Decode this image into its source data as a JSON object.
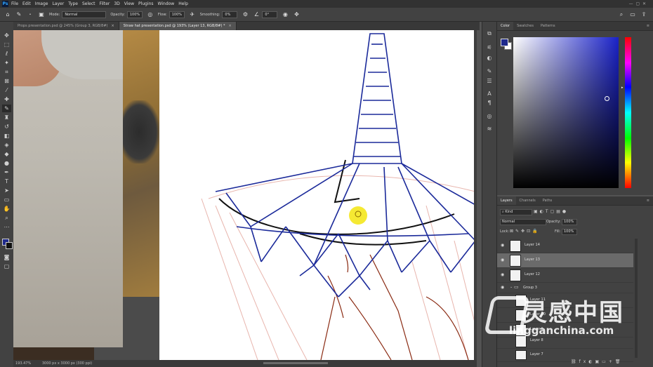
{
  "app": {
    "menu": [
      "File",
      "Edit",
      "Image",
      "Layer",
      "Type",
      "Select",
      "Filter",
      "3D",
      "View",
      "Plugins",
      "Window",
      "Help"
    ]
  },
  "options": {
    "mode_label": "Mode:",
    "mode_value": "Normal",
    "opacity_label": "Opacity:",
    "opacity_value": "100%",
    "flow_label": "Flow:",
    "flow_value": "100%",
    "smoothing_label": "Smoothing:",
    "smoothing_value": "0%",
    "angle_value": "0°"
  },
  "tabs": [
    {
      "label": "Props presentation.psd @ 245% (Group 3, RGB/8#)"
    },
    {
      "label": "Straw hat presentation.psd @ 193% (Layer 13, RGB/8#) *"
    }
  ],
  "status": {
    "zoom": "193.47%",
    "doc": "3000 px x 3000 px (300 ppi)"
  },
  "color_panel": {
    "tabs": [
      "Color",
      "Swatches",
      "Patterns"
    ],
    "fg_color": "#1f2a8c",
    "bg_color": "#ffffff",
    "hue_color": "#1a22c8"
  },
  "layers_panel": {
    "tabs": [
      "Layers",
      "Channels",
      "Paths"
    ],
    "kind_label": "Kind",
    "blend_mode": "Normal",
    "opacity_label": "Opacity:",
    "opacity_value": "100%",
    "lock_label": "Lock:",
    "fill_label": "Fill:",
    "fill_value": "100%",
    "layers": [
      {
        "name": "Layer 14"
      },
      {
        "name": "Layer 13"
      },
      {
        "name": "Layer 12"
      },
      {
        "name": "Group 3"
      },
      {
        "name": "Layer 11"
      },
      {
        "name": "Layer 10"
      },
      {
        "name": "Layer 9"
      },
      {
        "name": "Layer 8"
      },
      {
        "name": "Layer 7"
      }
    ]
  },
  "watermark": {
    "cn": "灵感中国",
    "url": "lingganchina.com"
  }
}
